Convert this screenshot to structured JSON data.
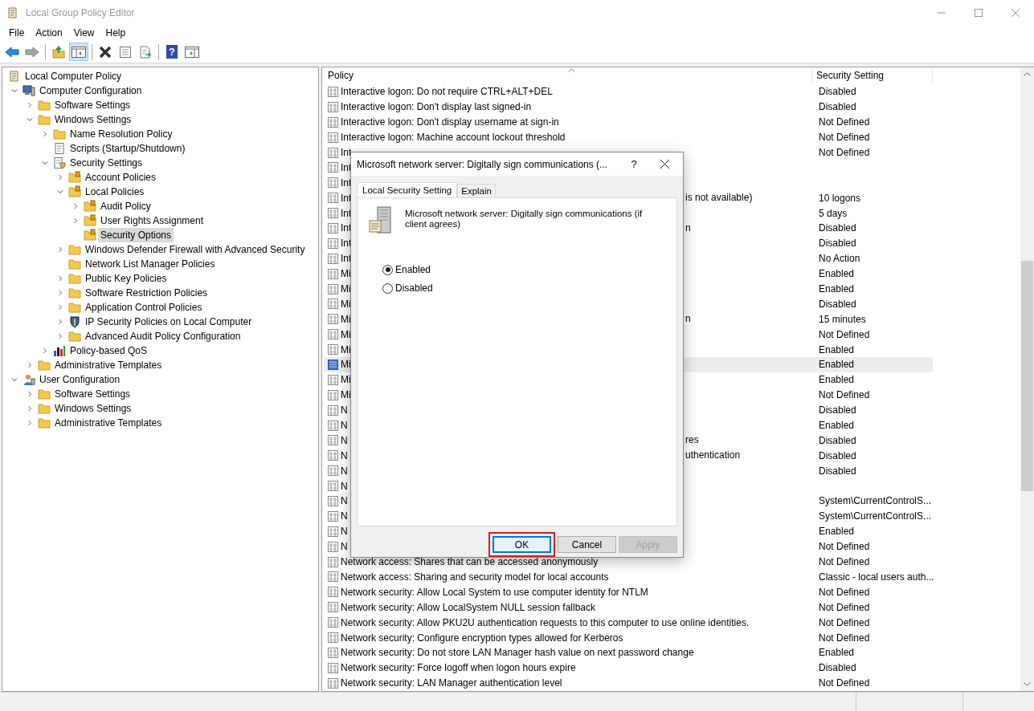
{
  "window": {
    "title": "Local Group Policy Editor"
  },
  "menu": [
    "File",
    "Action",
    "View",
    "Help"
  ],
  "toolbar": [
    [
      {
        "kind": "back",
        "disabled": false,
        "pressed": false
      },
      {
        "kind": "forward",
        "disabled": true,
        "pressed": false
      }
    ],
    [
      {
        "kind": "up",
        "disabled": false,
        "pressed": false
      },
      {
        "kind": "tree-toggle",
        "disabled": false,
        "pressed": true
      }
    ],
    [
      {
        "kind": "delete",
        "disabled": false,
        "pressed": false
      },
      {
        "kind": "properties",
        "disabled": false,
        "pressed": false
      },
      {
        "kind": "export",
        "disabled": false,
        "pressed": false
      }
    ],
    [
      {
        "kind": "help",
        "glyph": "?",
        "disabled": false,
        "pressed": false
      },
      {
        "kind": "action-pane",
        "disabled": false,
        "pressed": false
      }
    ]
  ],
  "tree": [
    {
      "label": "Local Computer Policy",
      "kind": "document",
      "selected": false,
      "children": [
        {
          "label": "Computer Configuration",
          "kind": "computer",
          "selected": false,
          "expanded": true,
          "children": [
            {
              "label": "Software Settings",
              "kind": "folder",
              "selected": false,
              "expanded": false
            },
            {
              "label": "Windows Settings",
              "kind": "folder",
              "selected": false,
              "expanded": true,
              "children": [
                {
                  "label": "Name Resolution Policy",
                  "kind": "folder",
                  "selected": false,
                  "expanded": false
                },
                {
                  "label": "Scripts (Startup/Shutdown)",
                  "kind": "script",
                  "selected": false
                },
                {
                  "label": "Security Settings",
                  "kind": "security",
                  "selected": false,
                  "expanded": true,
                  "children": [
                    {
                      "label": "Account Policies",
                      "kind": "locked-folder",
                      "selected": false,
                      "expanded": false
                    },
                    {
                      "label": "Local Policies",
                      "kind": "locked-folder",
                      "selected": false,
                      "expanded": true,
                      "children": [
                        {
                          "label": "Audit Policy",
                          "kind": "locked-folder",
                          "selected": false,
                          "expanded": false
                        },
                        {
                          "label": "User Rights Assignment",
                          "kind": "locked-folder",
                          "selected": false,
                          "expanded": false
                        },
                        {
                          "label": "Security Options",
                          "kind": "locked-folder",
                          "selected": true
                        }
                      ]
                    },
                    {
                      "label": "Windows Defender Firewall with Advanced Security",
                      "kind": "folder",
                      "selected": false,
                      "expanded": false
                    },
                    {
                      "label": "Network List Manager Policies",
                      "kind": "folder",
                      "selected": false
                    },
                    {
                      "label": "Public Key Policies",
                      "kind": "folder",
                      "selected": false,
                      "expanded": false
                    },
                    {
                      "label": "Software Restriction Policies",
                      "kind": "folder",
                      "selected": false,
                      "expanded": false
                    },
                    {
                      "label": "Application Control Policies",
                      "kind": "folder",
                      "selected": false,
                      "expanded": false
                    },
                    {
                      "label": "IP Security Policies on Local Computer",
                      "kind": "shield",
                      "selected": false,
                      "expanded": false
                    },
                    {
                      "label": "Advanced Audit Policy Configuration",
                      "kind": "folder",
                      "selected": false,
                      "expanded": false
                    }
                  ]
                },
                {
                  "label": "Policy-based QoS",
                  "kind": "chart",
                  "selected": false,
                  "expanded": false
                }
              ]
            },
            {
              "label": "Administrative Templates",
              "kind": "folder",
              "selected": false,
              "expanded": false
            }
          ]
        },
        {
          "label": "User Configuration",
          "kind": "user",
          "selected": false,
          "expanded": true,
          "children": [
            {
              "label": "Software Settings",
              "kind": "folder",
              "selected": false,
              "expanded": false
            },
            {
              "label": "Windows Settings",
              "kind": "folder",
              "selected": false,
              "expanded": false
            },
            {
              "label": "Administrative Templates",
              "kind": "folder",
              "selected": false,
              "expanded": false
            }
          ]
        }
      ]
    }
  ],
  "columns": [
    {
      "label": "Policy",
      "sorted": true
    },
    {
      "label": "Security Setting",
      "sorted": false
    }
  ],
  "rows": [
    {
      "policy": "Interactive logon: Do not require CTRL+ALT+DEL",
      "setting": "Disabled",
      "selected": false
    },
    {
      "policy": "Interactive logon: Don't display last signed-in",
      "setting": "Disabled",
      "selected": false
    },
    {
      "policy": "Interactive logon: Don't display username at sign-in",
      "setting": "Not Defined",
      "selected": false
    },
    {
      "policy": "Interactive logon: Machine account lockout threshold",
      "setting": "Not Defined",
      "selected": false
    },
    {
      "policy": "Int",
      "setting": "Not Defined",
      "selected": false
    },
    {
      "policy": "Int",
      "selected": false
    },
    {
      "policy": "Int",
      "selected": false
    },
    {
      "policy": "Int",
      "tail": "is not available)",
      "setting": "10 logons",
      "selected": false
    },
    {
      "policy": "Int",
      "setting": "5 days",
      "selected": false
    },
    {
      "policy": "Int",
      "tail": "n",
      "setting": "Disabled",
      "selected": false
    },
    {
      "policy": "Int",
      "setting": "Disabled",
      "selected": false
    },
    {
      "policy": "Int",
      "setting": "No Action",
      "selected": false
    },
    {
      "policy": "Mi",
      "setting": "Enabled",
      "selected": false
    },
    {
      "policy": "Mi",
      "setting": "Enabled",
      "selected": false
    },
    {
      "policy": "Mi",
      "setting": "Disabled",
      "selected": false
    },
    {
      "policy": "Mi",
      "tail": "n",
      "setting": "15 minutes",
      "selected": false
    },
    {
      "policy": "Mi",
      "setting": "Not Defined",
      "selected": false
    },
    {
      "policy": "Mi",
      "setting": "Enabled",
      "selected": false
    },
    {
      "policy": "Mi",
      "setting": "Enabled",
      "selected": true
    },
    {
      "policy": "Mi",
      "setting": "Enabled",
      "selected": false
    },
    {
      "policy": "Mi",
      "setting": "Not Defined",
      "selected": false
    },
    {
      "policy": "N",
      "setting": "Disabled",
      "selected": false
    },
    {
      "policy": "N",
      "setting": "Enabled",
      "selected": false
    },
    {
      "policy": "N",
      "tail": "res",
      "setting": "Disabled",
      "selected": false
    },
    {
      "policy": "N",
      "tail": "uthentication",
      "setting": "Disabled",
      "selected": false
    },
    {
      "policy": "N",
      "setting": "Disabled",
      "selected": false
    },
    {
      "policy": "N",
      "selected": false
    },
    {
      "policy": "N",
      "setting": "System\\CurrentControlS...",
      "selected": false
    },
    {
      "policy": "N",
      "setting": "System\\CurrentControlS...",
      "selected": false
    },
    {
      "policy": "N",
      "setting": "Enabled",
      "selected": false
    },
    {
      "policy": "N",
      "setting": "Not Defined",
      "selected": false
    },
    {
      "policy": "Network access: Shares that can be accessed anonymously",
      "setting": "Not Defined",
      "selected": false
    },
    {
      "policy": "Network access: Sharing and security model for local accounts",
      "setting": "Classic - local users auth...",
      "selected": false
    },
    {
      "policy": "Network security: Allow Local System to use computer identity for NTLM",
      "setting": "Not Defined",
      "selected": false
    },
    {
      "policy": "Network security: Allow LocalSystem NULL session fallback",
      "setting": "Not Defined",
      "selected": false
    },
    {
      "policy": "Network security: Allow PKU2U authentication requests to this computer to use online identities.",
      "setting": "Not Defined",
      "selected": false
    },
    {
      "policy": "Network security: Configure encryption types allowed for Kerberos",
      "setting": "Not Defined",
      "selected": false
    },
    {
      "policy": "Network security: Do not store LAN Manager hash value on next password change",
      "setting": "Enabled",
      "selected": false
    },
    {
      "policy": "Network security: Force logoff when logon hours expire",
      "setting": "Disabled",
      "selected": false
    },
    {
      "policy": "Network security: LAN Manager authentication level",
      "setting": "Not Defined",
      "selected": false
    }
  ],
  "dialog": {
    "title": "Microsoft network server: Digitally sign communications (...",
    "help": "?",
    "tabs": [
      {
        "label": "Local Security Setting",
        "selected": true
      },
      {
        "label": "Explain",
        "selected": false
      }
    ],
    "description": "Microsoft network server: Digitally sign communications (if client agrees)",
    "options": [
      {
        "label": "Enabled",
        "selected": true
      },
      {
        "label": "Disabled",
        "selected": false
      }
    ],
    "buttons": [
      {
        "label": "OK",
        "focused": true,
        "disabled": false,
        "highlighted": true
      },
      {
        "label": "Cancel",
        "focused": false,
        "disabled": false,
        "highlighted": false
      },
      {
        "label": "Apply",
        "focused": false,
        "disabled": true,
        "highlighted": false
      }
    ]
  }
}
